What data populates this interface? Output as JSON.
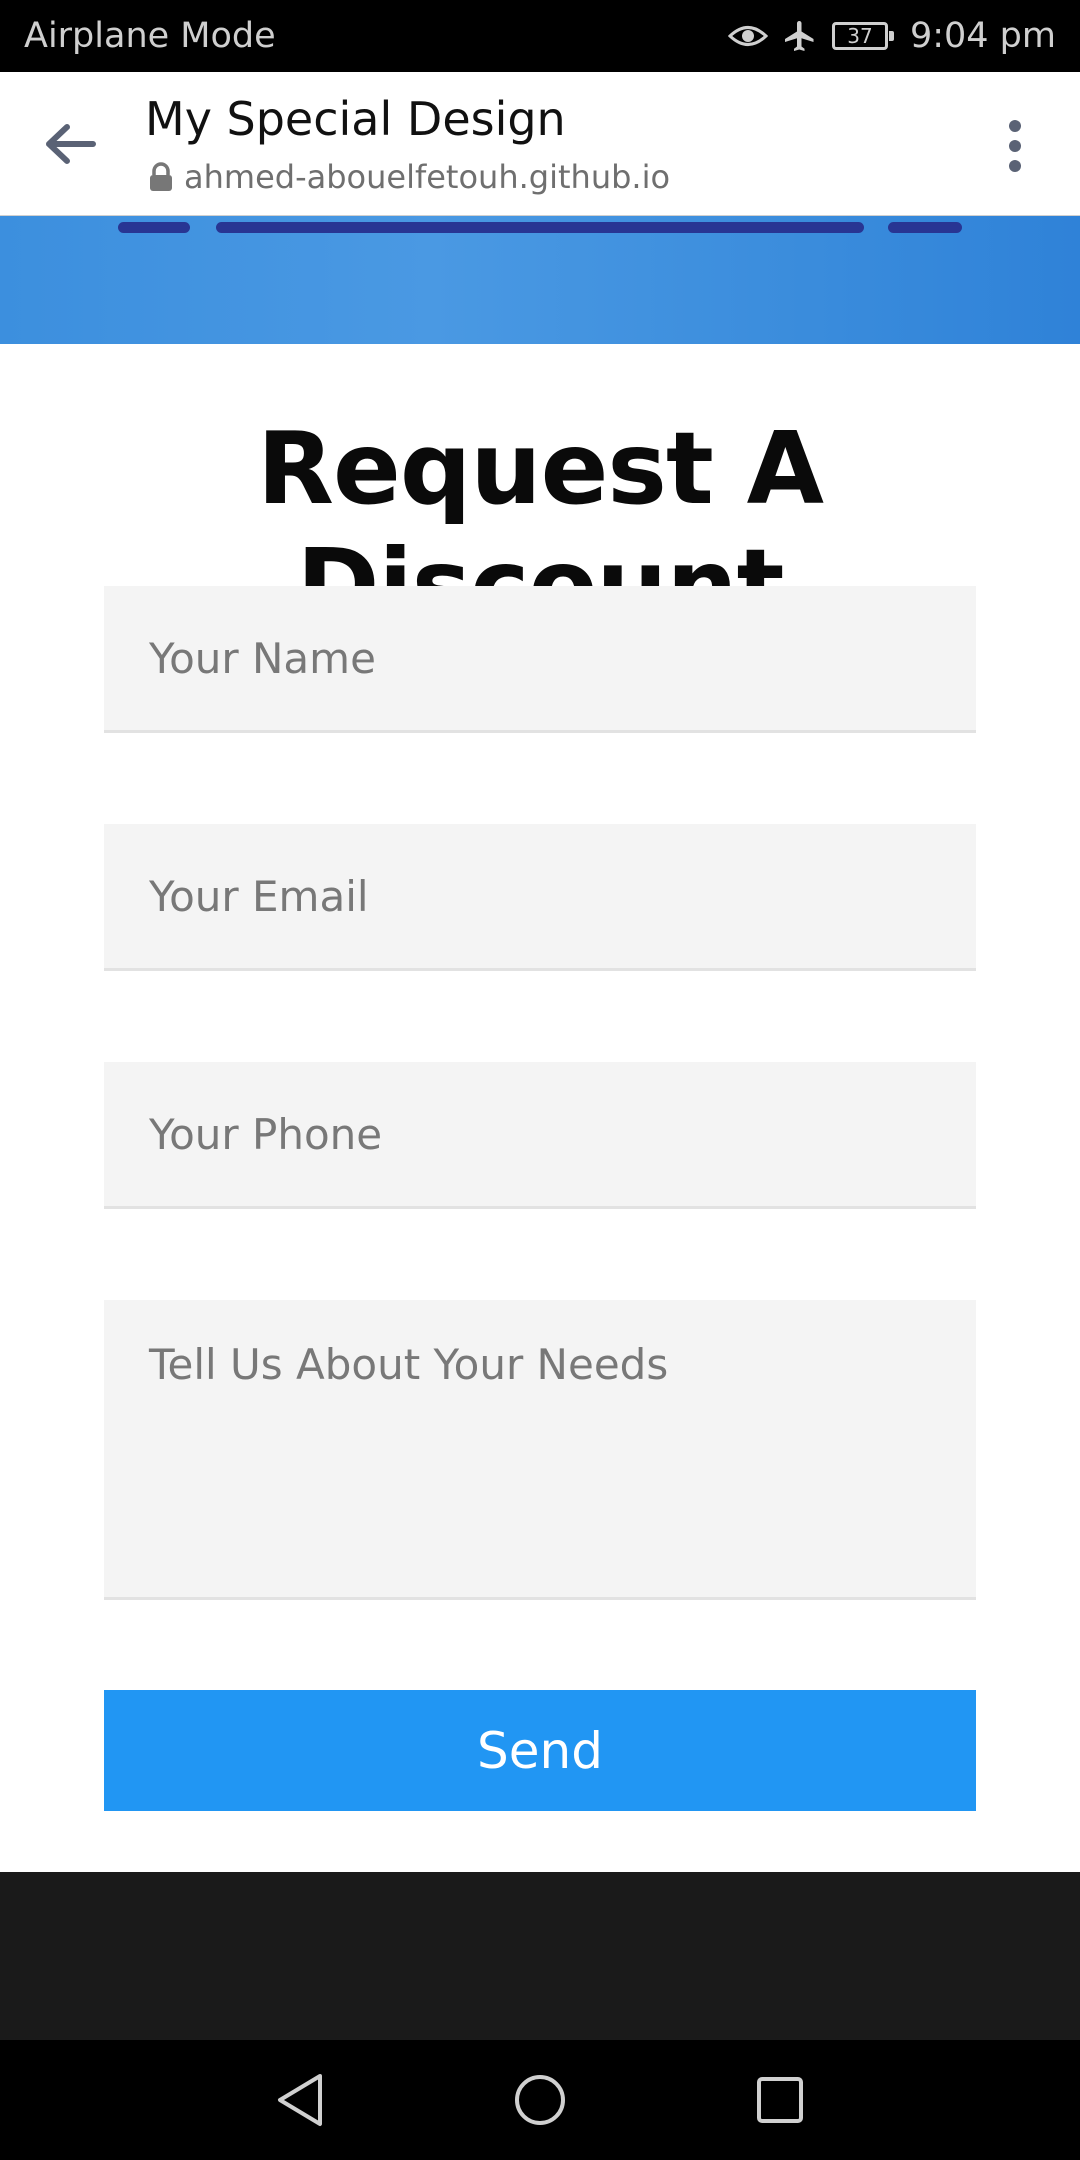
{
  "status_bar": {
    "left_text": "Airplane Mode",
    "battery": "37",
    "time": "9:04 pm",
    "icons": [
      "eye-icon",
      "airplane-icon",
      "battery-icon"
    ]
  },
  "browser": {
    "title": "My Special Design",
    "url": "ahmed-abouelfetouh.github.io",
    "icons": [
      "back-arrow-icon",
      "lock-icon",
      "more-vert-icon"
    ]
  },
  "form": {
    "title": "Request A Discount",
    "name_placeholder": "Your Name",
    "email_placeholder": "Your Email",
    "phone_placeholder": "Your Phone",
    "needs_placeholder": "Tell Us About Your Needs",
    "send_label": "Send"
  },
  "colors": {
    "accent": "#2196f3",
    "hero": "#3c8fde",
    "scroll_indicator": "#283593",
    "footer": "#1a1a1a"
  },
  "nav_bar": {
    "icons": [
      "nav-back-icon",
      "nav-home-icon",
      "nav-recents-icon"
    ]
  }
}
